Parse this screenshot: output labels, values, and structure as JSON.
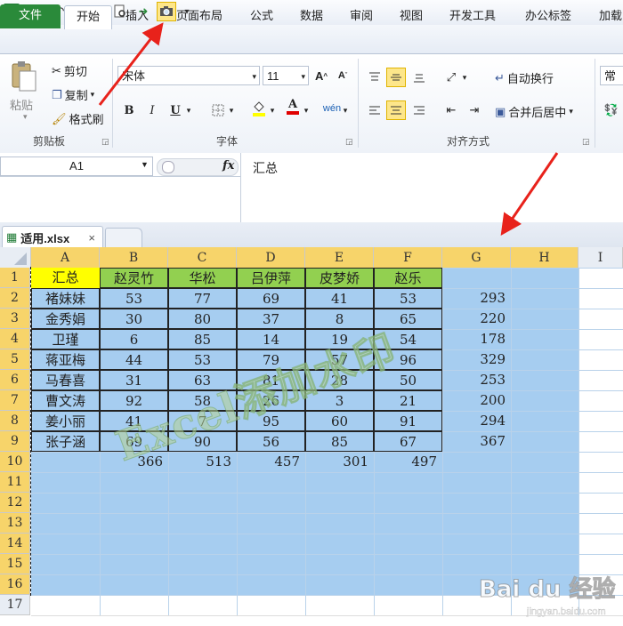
{
  "window": {
    "quick_access": {
      "excel_icon": "X"
    },
    "tabs": [
      "文件",
      "开始",
      "插入",
      "页面布局",
      "公式",
      "数据",
      "审阅",
      "视图",
      "开发工具",
      "办公标签",
      "加载"
    ]
  },
  "ribbon": {
    "clipboard": {
      "paste": "粘贴",
      "cut": "剪切",
      "copy": "复制",
      "format_painter": "格式刷",
      "label": "剪贴板"
    },
    "font": {
      "name": "宋体",
      "size": "11",
      "bold": "B",
      "italic": "I",
      "underline": "U",
      "label": "字体",
      "font_color_glyph": "A"
    },
    "alignment": {
      "wrap_text": "自动换行",
      "merge_center": "合并后居中",
      "label": "对齐方式"
    },
    "number": {
      "format": "常规"
    }
  },
  "formula_bar": {
    "name_box": "A1",
    "fx": "fx",
    "content": "汇总"
  },
  "workbook_tab": {
    "name": "适用.xlsx",
    "close": "×"
  },
  "columns": [
    "A",
    "B",
    "C",
    "D",
    "E",
    "F",
    "G",
    "H",
    "I"
  ],
  "rows": [
    "1",
    "2",
    "3",
    "4",
    "5",
    "6",
    "7",
    "8",
    "9",
    "10",
    "11",
    "12",
    "13",
    "14",
    "15",
    "16",
    "17"
  ],
  "table": {
    "header": [
      "汇总",
      "赵灵竹",
      "华松",
      "吕伊萍",
      "皮梦娇",
      "赵乐"
    ],
    "names": [
      "褚妹妹",
      "金秀娟",
      "卫瑾",
      "蒋亚梅",
      "马春喜",
      "曹文涛",
      "姜小丽",
      "张子涵"
    ],
    "values": [
      [
        53,
        77,
        69,
        41,
        53
      ],
      [
        30,
        80,
        37,
        8,
        65
      ],
      [
        6,
        85,
        14,
        19,
        54
      ],
      [
        44,
        53,
        79,
        57,
        96
      ],
      [
        31,
        63,
        81,
        28,
        50
      ],
      [
        92,
        58,
        26,
        3,
        21
      ],
      [
        41,
        7,
        95,
        60,
        91
      ],
      [
        69,
        90,
        56,
        85,
        67
      ]
    ],
    "row_totals": [
      293,
      220,
      178,
      329,
      253,
      200,
      294,
      367
    ],
    "col_totals": [
      366,
      513,
      457,
      301,
      497
    ]
  },
  "watermark": "Excel添加水印",
  "baidu": {
    "logo": "Bai du 经验",
    "url": "jingyan.baidu.com"
  },
  "colors": {
    "header_yellow": "#ffff00",
    "header_green": "#92d050",
    "selection_blue": "#a6cdf0",
    "arrow_red": "#e8221b"
  }
}
